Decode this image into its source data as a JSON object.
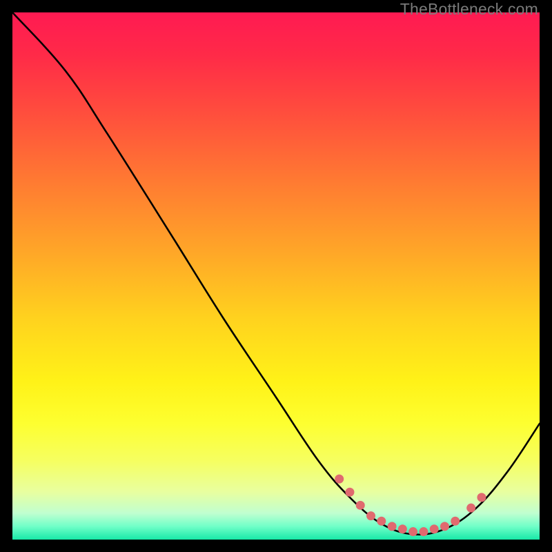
{
  "watermark": "TheBottleneck.com",
  "colors": {
    "curve": "#000000",
    "dot_fill": "#e06a6f",
    "dot_stroke": "#e06a6f"
  },
  "chart_data": {
    "type": "line",
    "title": "",
    "xlabel": "",
    "ylabel": "",
    "xlim": [
      0,
      100
    ],
    "ylim": [
      0,
      100
    ],
    "curve": [
      {
        "x": 0,
        "y": 100
      },
      {
        "x": 10,
        "y": 89
      },
      {
        "x": 18,
        "y": 77
      },
      {
        "x": 30,
        "y": 58
      },
      {
        "x": 40,
        "y": 42
      },
      {
        "x": 50,
        "y": 27
      },
      {
        "x": 58,
        "y": 15
      },
      {
        "x": 64,
        "y": 8
      },
      {
        "x": 70,
        "y": 3
      },
      {
        "x": 76,
        "y": 1
      },
      {
        "x": 82,
        "y": 2
      },
      {
        "x": 88,
        "y": 6
      },
      {
        "x": 94,
        "y": 13
      },
      {
        "x": 100,
        "y": 22
      }
    ],
    "dots": [
      {
        "x": 62,
        "y": 11.5
      },
      {
        "x": 64,
        "y": 9
      },
      {
        "x": 66,
        "y": 6.5
      },
      {
        "x": 68,
        "y": 4.5
      },
      {
        "x": 70,
        "y": 3.5
      },
      {
        "x": 72,
        "y": 2.5
      },
      {
        "x": 74,
        "y": 2
      },
      {
        "x": 76,
        "y": 1.5
      },
      {
        "x": 78,
        "y": 1.5
      },
      {
        "x": 80,
        "y": 2
      },
      {
        "x": 82,
        "y": 2.5
      },
      {
        "x": 84,
        "y": 3.5
      },
      {
        "x": 87,
        "y": 6
      },
      {
        "x": 89,
        "y": 8
      }
    ]
  }
}
